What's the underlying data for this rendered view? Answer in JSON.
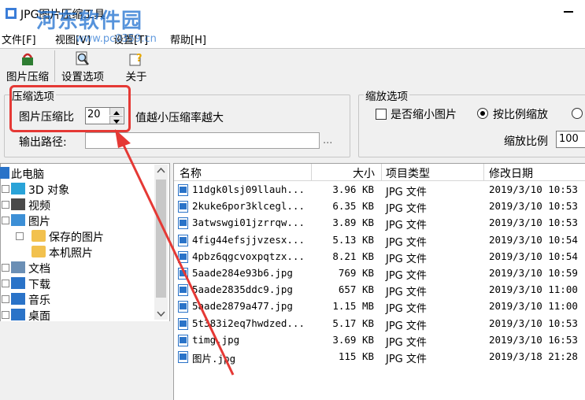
{
  "window": {
    "title": "JPG图片压缩工具"
  },
  "watermark": {
    "text": "河东软件园",
    "url": "www.pc0359.cn"
  },
  "menu": [
    {
      "label": "文件[F]"
    },
    {
      "label": "视图[V]"
    },
    {
      "label": "设置[T]"
    },
    {
      "label": "帮助[H]"
    }
  ],
  "toolbar": {
    "compress": "图片压缩",
    "settings": "设置选项",
    "about": "关于"
  },
  "compress_group": {
    "legend": "压缩选项",
    "ratio_label": "图片压缩比",
    "ratio_value": "20",
    "hint": "值越小压缩率越大",
    "output_label": "输出路径:",
    "output_value": "",
    "browse": "..."
  },
  "zoom_group": {
    "legend": "缩放选项",
    "shrink_label": "是否缩小图片",
    "proportional_label": "按比例缩放",
    "ratio_label": "缩放比例",
    "ratio_value": "100"
  },
  "tree": [
    {
      "label": "此电脑",
      "icon": "pc-icon",
      "level": 0
    },
    {
      "label": "3D 对象",
      "icon": "cube-icon",
      "level": 1
    },
    {
      "label": "视频",
      "icon": "video-icon",
      "level": 1
    },
    {
      "label": "图片",
      "icon": "pictures-icon",
      "level": 1
    },
    {
      "label": "保存的图片",
      "icon": "folder-icon",
      "level": 2
    },
    {
      "label": "本机照片",
      "icon": "folder-icon",
      "level": 2
    },
    {
      "label": "文档",
      "icon": "document-icon",
      "level": 1
    },
    {
      "label": "下载",
      "icon": "download-icon",
      "level": 1
    },
    {
      "label": "音乐",
      "icon": "music-icon",
      "level": 1
    },
    {
      "label": "桌面",
      "icon": "desktop-icon",
      "level": 1
    }
  ],
  "columns": {
    "name": "名称",
    "size": "大小",
    "type": "项目类型",
    "modified": "修改日期"
  },
  "files": [
    {
      "name": "11dgk0lsj09llauh...",
      "size": "3.96 KB",
      "type": "JPG 文件",
      "modified": "2019/3/10 10:53"
    },
    {
      "name": "2kuke6por3klcegl...",
      "size": "6.35 KB",
      "type": "JPG 文件",
      "modified": "2019/3/10 10:53"
    },
    {
      "name": "3atwswgi01jzrrqw...",
      "size": "3.89 KB",
      "type": "JPG 文件",
      "modified": "2019/3/10 10:53"
    },
    {
      "name": "4fig44efsjjvzesx...",
      "size": "5.13 KB",
      "type": "JPG 文件",
      "modified": "2019/3/10 10:54"
    },
    {
      "name": "4pbz6qgcvoxpqtzx...",
      "size": "8.21 KB",
      "type": "JPG 文件",
      "modified": "2019/3/10 10:54"
    },
    {
      "name": "5aade284e93b6.jpg",
      "size": "769 KB",
      "type": "JPG 文件",
      "modified": "2019/3/10 10:59"
    },
    {
      "name": "5aade2835ddc9.jpg",
      "size": "657 KB",
      "type": "JPG 文件",
      "modified": "2019/3/10 11:00"
    },
    {
      "name": "5aade2879a477.jpg",
      "size": "1.15 MB",
      "type": "JPG 文件",
      "modified": "2019/3/10 11:00"
    },
    {
      "name": "5t383i2eq7hwdzed...",
      "size": "5.17 KB",
      "type": "JPG 文件",
      "modified": "2019/3/10 10:53"
    },
    {
      "name": "timg.jpg",
      "size": "3.69 KB",
      "type": "JPG 文件",
      "modified": "2019/3/10 16:53"
    },
    {
      "name": "图片.jpg",
      "size": "115 KB",
      "type": "JPG 文件",
      "modified": "2019/3/18 21:28"
    }
  ],
  "colors": {
    "annotation_red": "#e53935",
    "watermark_blue": "#1e6fd0",
    "icon_blue": "#2a73c8"
  }
}
